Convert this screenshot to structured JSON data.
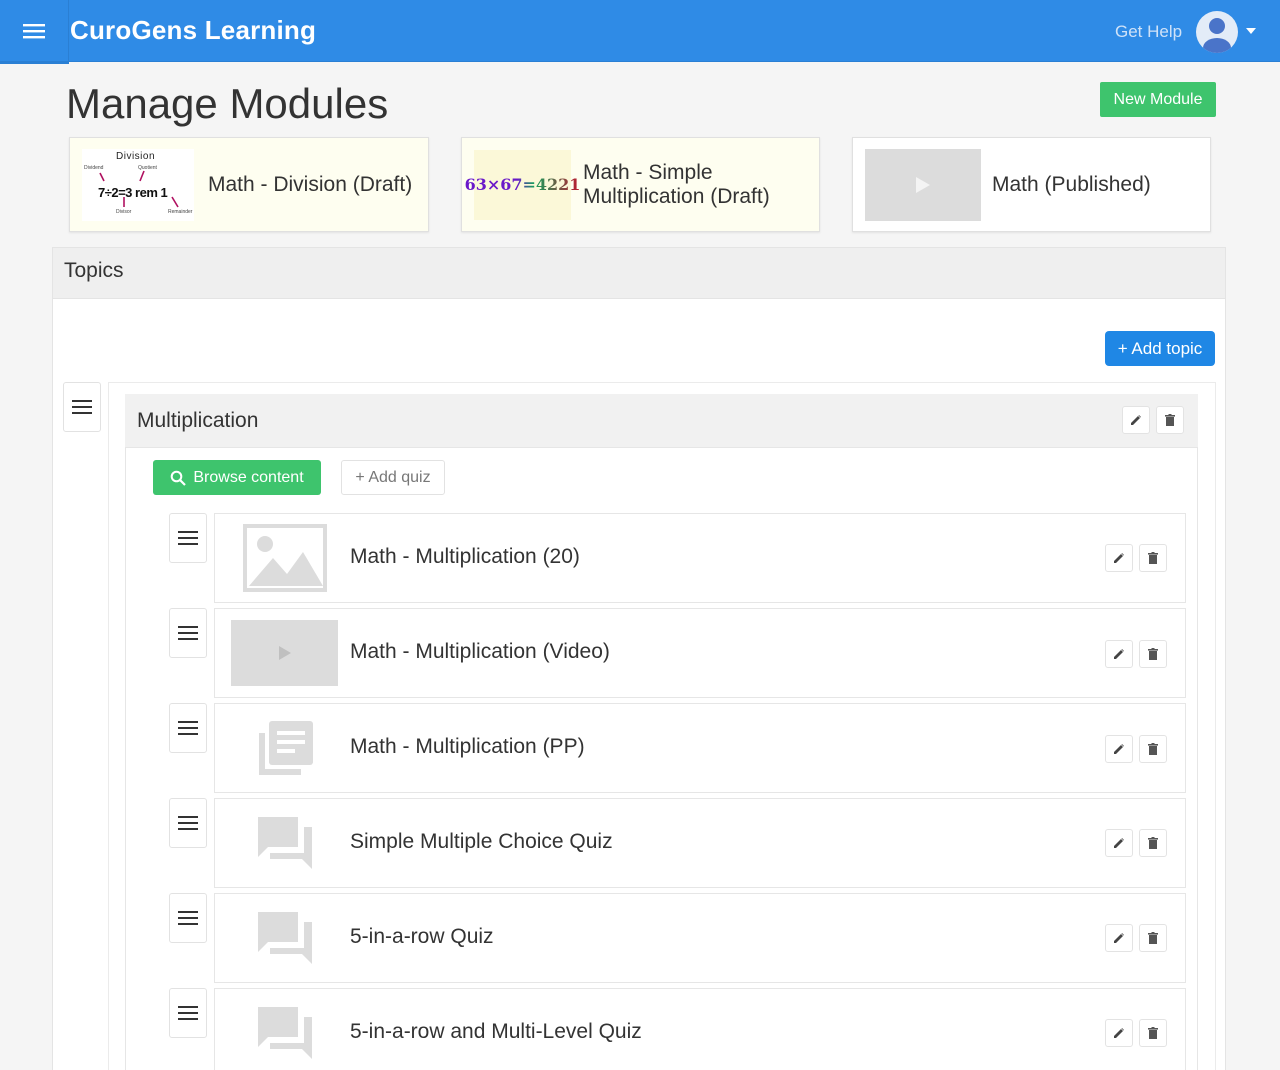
{
  "app": {
    "title": "CuroGens Learning",
    "get_help": "Get Help",
    "brand_color": "#2f8be6"
  },
  "page": {
    "title": "Manage Modules",
    "new_module_label": "New Module"
  },
  "modules": [
    {
      "label": "Math - Division (Draft)",
      "status": "draft",
      "thumbnail": "division-diagram"
    },
    {
      "label": "Math - Simple Multiplication (Draft)",
      "label_line1": "Math - Simple",
      "label_line2": "Multiplication (Draft)",
      "status": "draft",
      "thumbnail": "multiplication-equation",
      "thumb_text": "63×67=4221"
    },
    {
      "label": "Math (Published)",
      "status": "published",
      "thumbnail": "video-placeholder"
    }
  ],
  "division_thumb": {
    "heading": "Division",
    "equation": "7÷2=3 rem 1",
    "labels": [
      "Dividend",
      "Quotient",
      "Divisor",
      "Remainder"
    ]
  },
  "topics": {
    "title": "Topics",
    "add_topic_label": "+ Add topic",
    "items": [
      {
        "name": "Multiplication",
        "browse_content_label": "Browse content",
        "add_quiz_label": "+ Add quiz",
        "contents": [
          {
            "label": "Math - Multiplication (20)",
            "icon": "image-icon"
          },
          {
            "label": "Math - Multiplication (Video)",
            "icon": "video-icon"
          },
          {
            "label": "Math - Multiplication (PP)",
            "icon": "library-books-icon"
          },
          {
            "label": "Simple Multiple Choice Quiz",
            "icon": "forum-icon"
          },
          {
            "label": "5-in-a-row Quiz",
            "icon": "forum-icon"
          },
          {
            "label": "5-in-a-row and Multi-Level Quiz",
            "icon": "forum-icon"
          }
        ]
      }
    ]
  }
}
